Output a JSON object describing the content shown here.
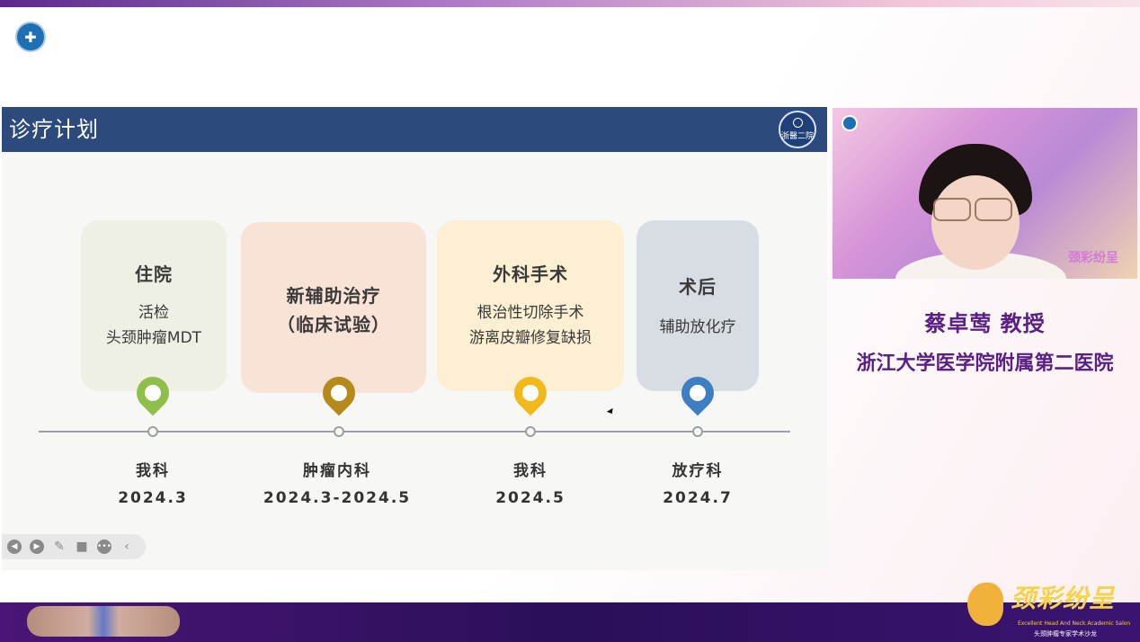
{
  "slide": {
    "title": "诊疗计划",
    "emblem_text": "浙醫二院"
  },
  "stages": [
    {
      "title": "住院",
      "lines": [
        "活检",
        "头颈肿瘤MDT"
      ],
      "dept": "我科",
      "date": "2024.3",
      "pin_color": "#8fbf4a"
    },
    {
      "title_lines": [
        "新辅助治疗",
        "（临床试验）"
      ],
      "dept": "肿瘤内科",
      "date": "2024.3-2024.5",
      "pin_color": "#b5891a"
    },
    {
      "title": "外科手术",
      "lines": [
        "根治性切除手术",
        "游离皮瓣修复缺损"
      ],
      "dept": "我科",
      "date": "2024.5",
      "pin_color": "#f1b91a"
    },
    {
      "title": "术后",
      "lines": [
        "辅助放化疗"
      ],
      "dept": "放疗科",
      "date": "2024.7",
      "pin_color": "#3d7fc1"
    }
  ],
  "toolbar": {
    "icons": [
      "prev-icon",
      "next-icon",
      "pen-icon",
      "camera-icon",
      "more-icon",
      "collapse-icon"
    ]
  },
  "presenter": {
    "name": "蔡卓莺  教授",
    "org": "浙江大学医学院附属第二医院"
  },
  "brand": {
    "cn_title": "颈彩纷呈",
    "en_subtitle": "Excellent Head And Neck Academic Salon",
    "cn_subtitle": "头颈肿瘤专家学术沙龙"
  },
  "colors": {
    "header": "#2d4a7c",
    "presenter_text": "#5a1f85",
    "bottom_bar": "#2a0f5a"
  }
}
